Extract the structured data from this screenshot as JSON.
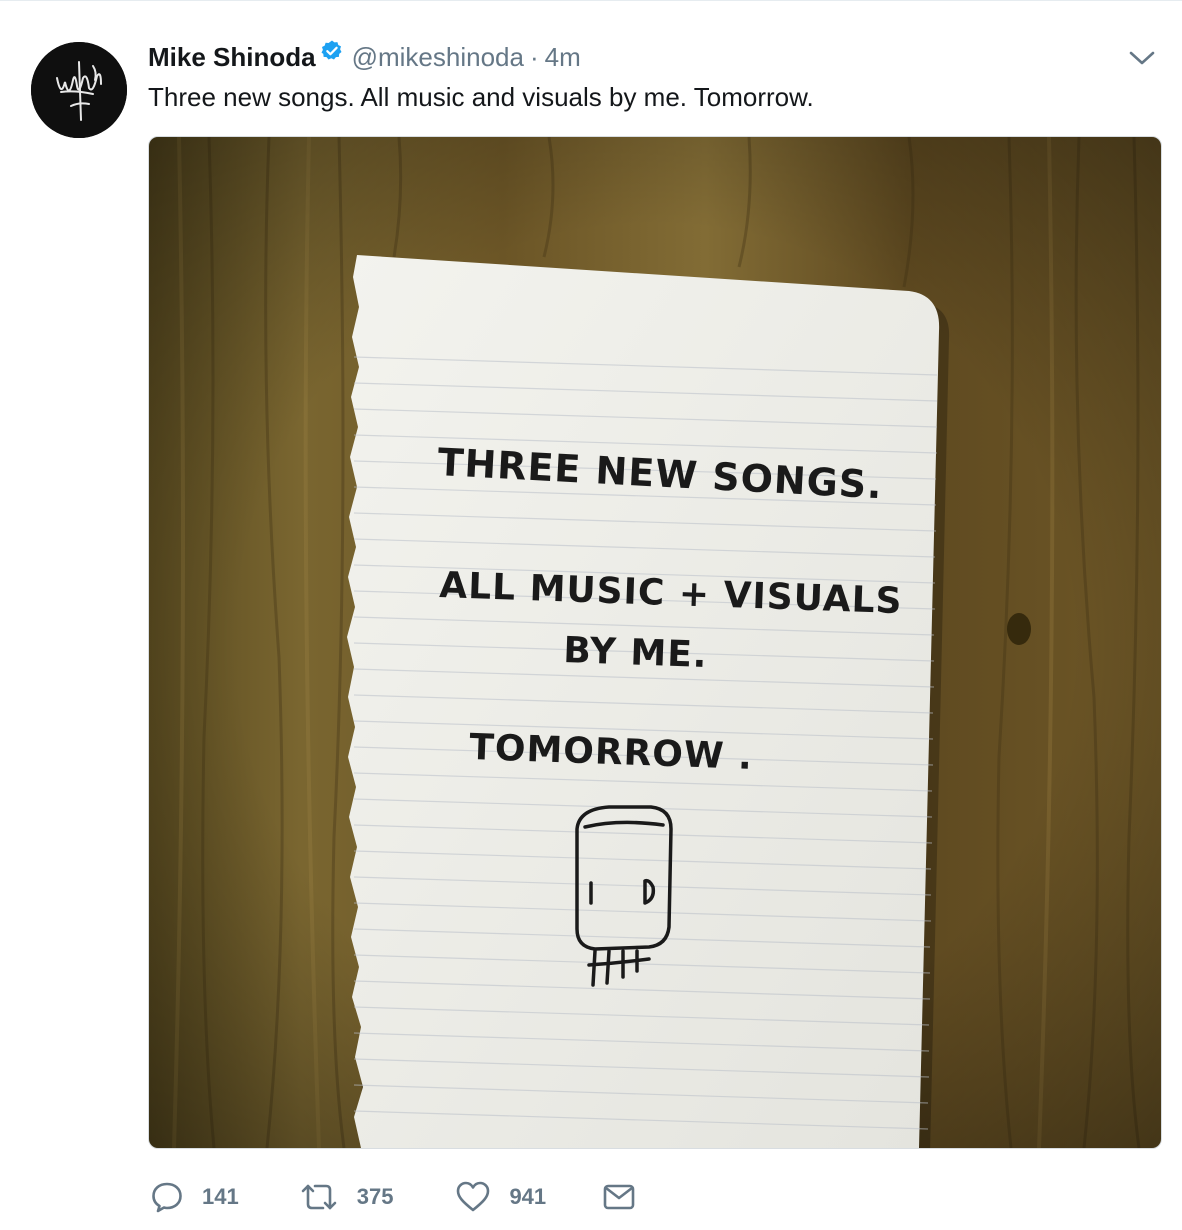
{
  "tweet": {
    "author": {
      "name": "Mike Shinoda",
      "handle": "@mikeshinoda",
      "verified": true,
      "avatar_icon": "signature-logo-avatar"
    },
    "separator": "·",
    "time": "4m",
    "text": "Three new songs. All music and visuals by me. Tomorrow.",
    "media": {
      "description_icon": "handwritten-note-photo",
      "note_lines": [
        "THREE NEW SONGS.",
        "ALL MUSIC + VISUALS",
        "BY ME.",
        "TOMORROW ."
      ]
    },
    "actions": {
      "replies": "141",
      "retweets": "375",
      "likes": "941"
    },
    "icons": {
      "reply": "reply-icon",
      "retweet": "retweet-icon",
      "like": "heart-icon",
      "dm": "envelope-icon",
      "more": "chevron-down-icon",
      "verified": "verified-badge-icon"
    },
    "colors": {
      "text": "#14171a",
      "secondary": "#657786",
      "verified": "#1da1f2",
      "border": "#e6ecf0"
    }
  }
}
